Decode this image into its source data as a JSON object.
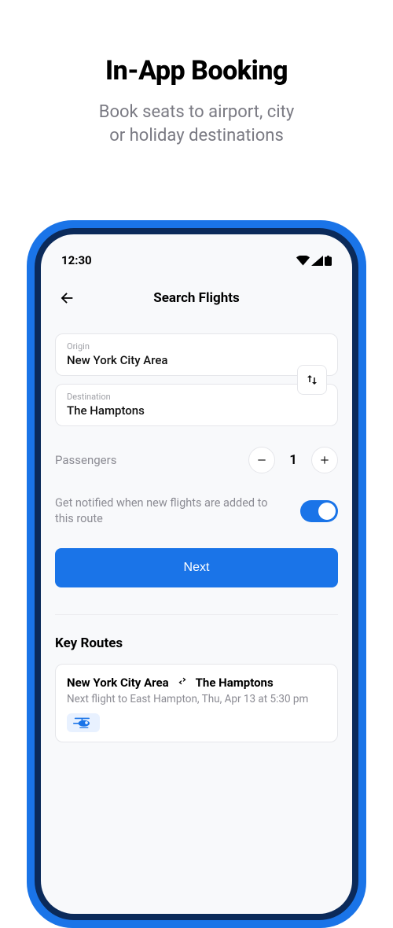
{
  "promo": {
    "title": "In-App Booking",
    "subtitle_line1": "Book seats to airport, city",
    "subtitle_line2": "or holiday destinations"
  },
  "status_bar": {
    "time": "12:30"
  },
  "header": {
    "title": "Search Flights"
  },
  "fields": {
    "origin_label": "Origin",
    "origin_value": "New York City Area",
    "destination_label": "Destination",
    "destination_value": "The Hamptons"
  },
  "passengers": {
    "label": "Passengers",
    "count": "1"
  },
  "notify": {
    "text": "Get notified when new flights are added to this route",
    "on": true
  },
  "next_label": "Next",
  "key_routes": {
    "title": "Key Routes",
    "items": [
      {
        "from": "New York City Area",
        "to": "The Hamptons",
        "subtitle": "Next flight to East Hampton, Thu, Apr 13 at 5:30 pm"
      }
    ]
  },
  "colors": {
    "accent": "#1a74e8"
  }
}
